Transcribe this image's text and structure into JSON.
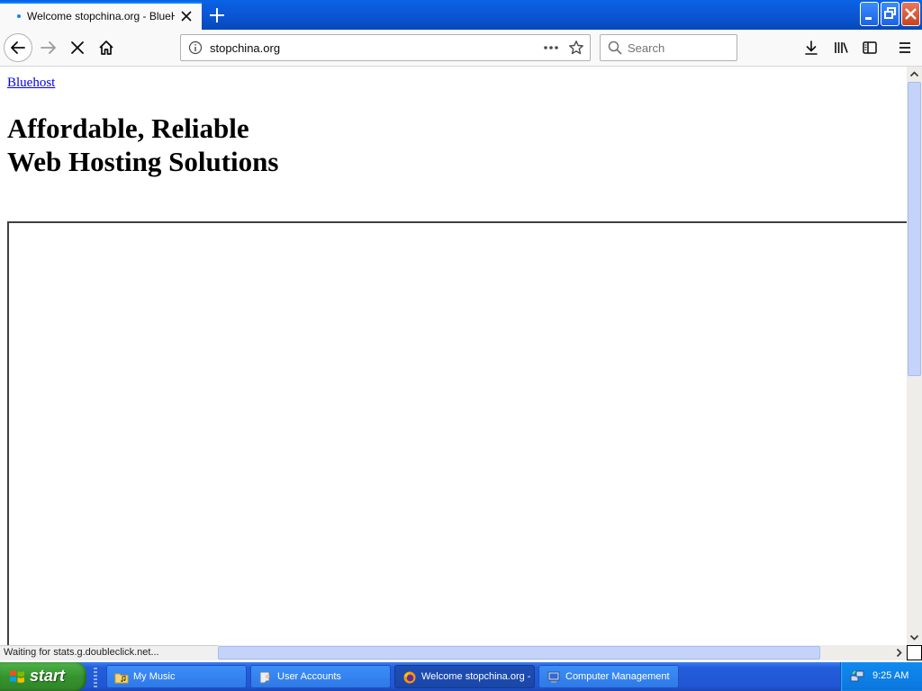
{
  "browser": {
    "tab": {
      "title": "Welcome stopchina.org - BlueHost.com"
    },
    "address": {
      "url": "stopchina.org"
    },
    "search": {
      "placeholder": "Search"
    },
    "status": "Waiting for stats.g.doubleclick.net..."
  },
  "page": {
    "link_text": "Bluehost",
    "headline_line1": "Affordable, Reliable",
    "headline_line2": "Web Hosting Solutions"
  },
  "taskbar": {
    "start_label": "start",
    "tasks": [
      {
        "label": "My Music",
        "icon": "folder-music-icon",
        "active": false
      },
      {
        "label": "User Accounts",
        "icon": "user-accounts-icon",
        "active": false
      },
      {
        "label": "Welcome stopchina.org - BlueHost.com",
        "icon": "firefox-icon",
        "active": true
      },
      {
        "label": "Computer Management",
        "icon": "computer-management-icon",
        "active": false
      }
    ],
    "clock": "9:25 AM"
  },
  "colors": {
    "tab_accent": "#0a84ff",
    "link": "#0000ee",
    "taskbar_blue": "#245edc",
    "start_green": "#36942f"
  }
}
